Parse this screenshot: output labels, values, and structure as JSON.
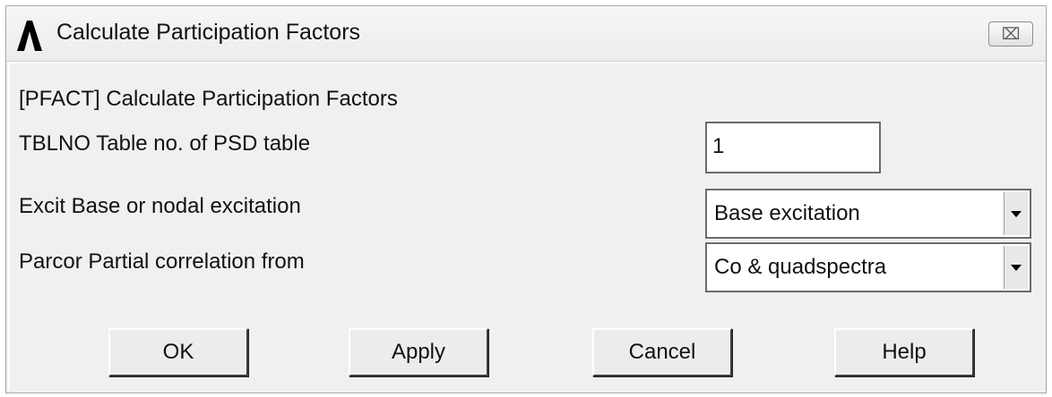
{
  "window": {
    "title": "Calculate Participation Factors",
    "close_glyph": "⌧"
  },
  "header_line": "[PFACT]  Calculate Participation Factors",
  "fields": {
    "tblno": {
      "label": "TBLNO   Table no. of PSD table",
      "value": "1"
    },
    "excit": {
      "label": "Excit   Base or nodal excitation",
      "selected": "Base excitation"
    },
    "parcor": {
      "label": "Parcor  Partial correlation from",
      "selected": "Co & quadspectra"
    }
  },
  "buttons": {
    "ok": "OK",
    "apply": "Apply",
    "cancel": "Cancel",
    "help": "Help"
  },
  "icons": {
    "app": "ansys-logo-icon",
    "close": "close-icon",
    "dropdown": "chevron-down-icon"
  }
}
